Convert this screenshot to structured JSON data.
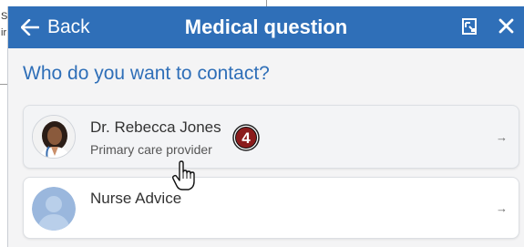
{
  "header": {
    "back_label": "Back",
    "title": "Medical question",
    "colors": {
      "bar": "#2f6fb8",
      "text": "#ffffff"
    }
  },
  "question": "Who do you want to contact?",
  "contacts": [
    {
      "name": "Dr. Rebecca Jones",
      "role": "Primary care provider",
      "arrow": "→",
      "icon": "provider-photo"
    },
    {
      "name": "Nurse Advice",
      "arrow": "→",
      "icon": "generic-person-avatar"
    }
  ],
  "annotation": {
    "step_number": "4"
  },
  "backdrop": {
    "line1": "S",
    "line2": "ir"
  }
}
